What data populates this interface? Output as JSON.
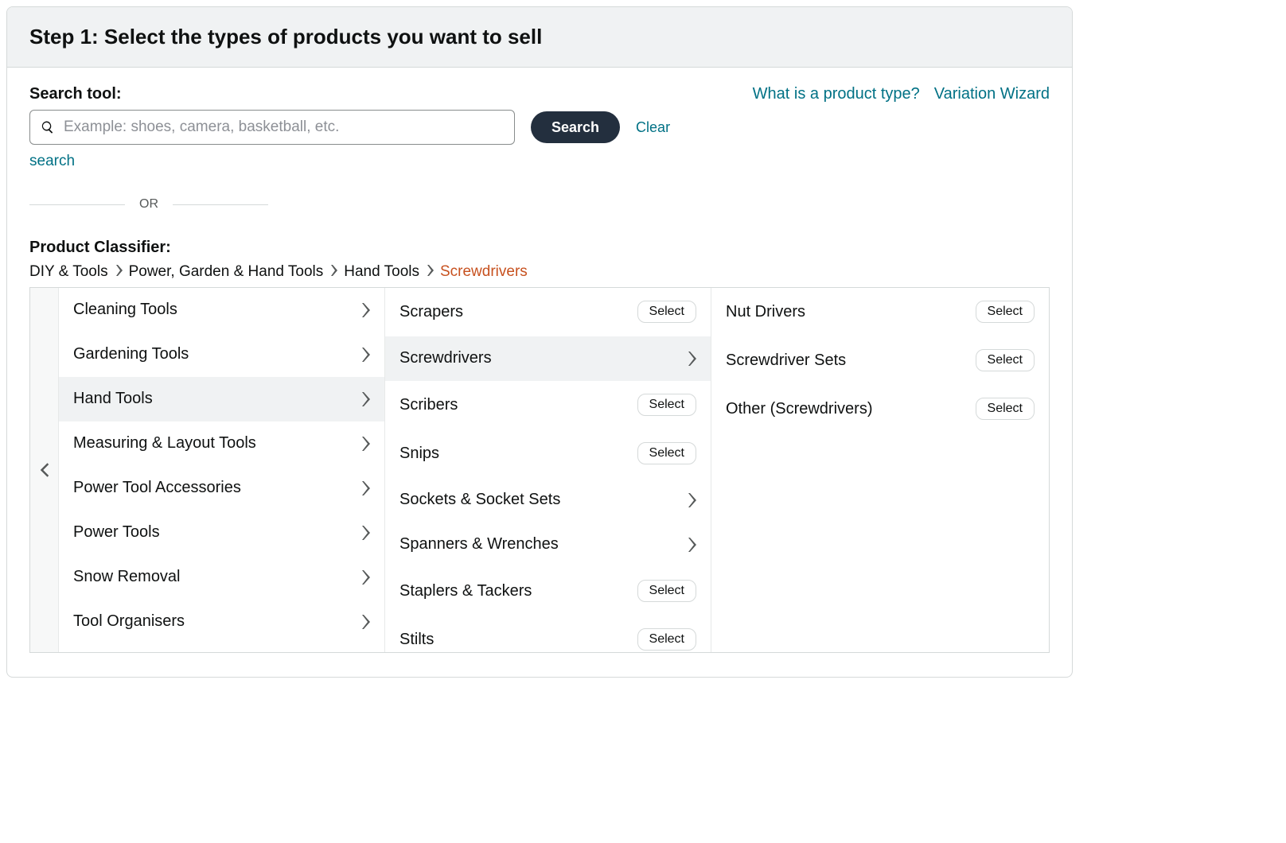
{
  "header": {
    "title": "Step 1: Select the types of products you want to sell"
  },
  "links": {
    "what_is": "What is a product type?",
    "variation": "Variation Wizard"
  },
  "search": {
    "label": "Search tool:",
    "placeholder": "Example: shoes, camera, basketball, etc.",
    "button": "Search",
    "clear": "Clear",
    "below": "search"
  },
  "or_text": "OR",
  "classifier": {
    "label": "Product Classifier:",
    "breadcrumbs": [
      "DIY & Tools",
      "Power, Garden & Hand Tools",
      "Hand Tools",
      "Screwdrivers"
    ],
    "select_label": "Select",
    "col1": [
      {
        "label": "Cleaning Tools",
        "expand": true
      },
      {
        "label": "Gardening Tools",
        "expand": true
      },
      {
        "label": "Hand Tools",
        "expand": true,
        "active": true
      },
      {
        "label": "Measuring & Layout Tools",
        "expand": true
      },
      {
        "label": "Power Tool Accessories",
        "expand": true
      },
      {
        "label": "Power Tools",
        "expand": true
      },
      {
        "label": "Snow Removal",
        "expand": true
      },
      {
        "label": "Tool Organisers",
        "expand": true
      }
    ],
    "col2": [
      {
        "label": "Scrapers",
        "select": true
      },
      {
        "label": "Screwdrivers",
        "expand": true,
        "active": true
      },
      {
        "label": "Scribers",
        "select": true
      },
      {
        "label": "Snips",
        "select": true
      },
      {
        "label": "Sockets & Socket Sets",
        "expand": true
      },
      {
        "label": "Spanners & Wrenches",
        "expand": true
      },
      {
        "label": "Staplers & Tackers",
        "select": true
      },
      {
        "label": "Stilts",
        "select": true
      }
    ],
    "col3": [
      {
        "label": "Nut Drivers",
        "select": true
      },
      {
        "label": "Screwdriver Sets",
        "select": true
      },
      {
        "label": "Other (Screwdrivers)",
        "select": true
      }
    ]
  }
}
